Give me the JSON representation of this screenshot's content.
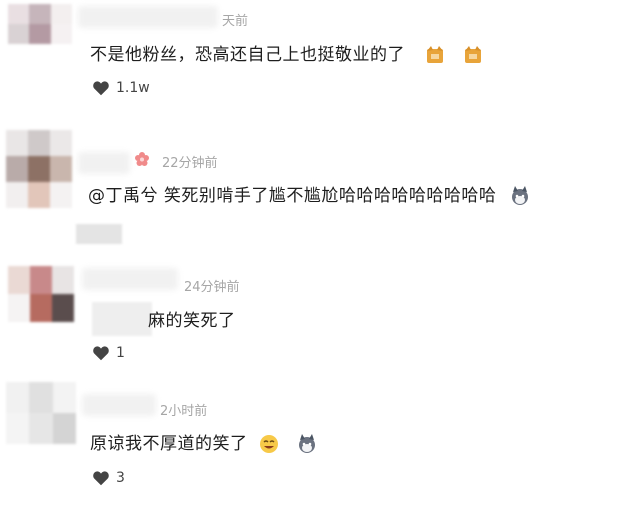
{
  "comments": [
    {
      "time": "天前",
      "text": "不是他粉丝，恐高还自己上也挺敬业的了",
      "likes": "1.1w",
      "emojis": [
        "cat-emoji",
        "cat-emoji"
      ]
    },
    {
      "time": "22分钟前",
      "text": "@丁禹兮 笑死别啃手了尴不尴尬哈哈哈哈哈哈哈哈哈",
      "likes": "",
      "emojis": [
        "husky-emoji"
      ],
      "badge": "flower-icon"
    },
    {
      "time": "24分钟前",
      "text": "麻的笑死了",
      "likes": "1",
      "emojis": []
    },
    {
      "time": "2小时前",
      "text": "原谅我不厚道的笑了",
      "likes": "3",
      "emojis": [
        "grin-emoji",
        "husky-emoji"
      ]
    }
  ],
  "colors": {
    "text": "#1e1e1e",
    "time": "#a6a6a6",
    "heart": "#444444",
    "badge": "#f08a8a"
  }
}
